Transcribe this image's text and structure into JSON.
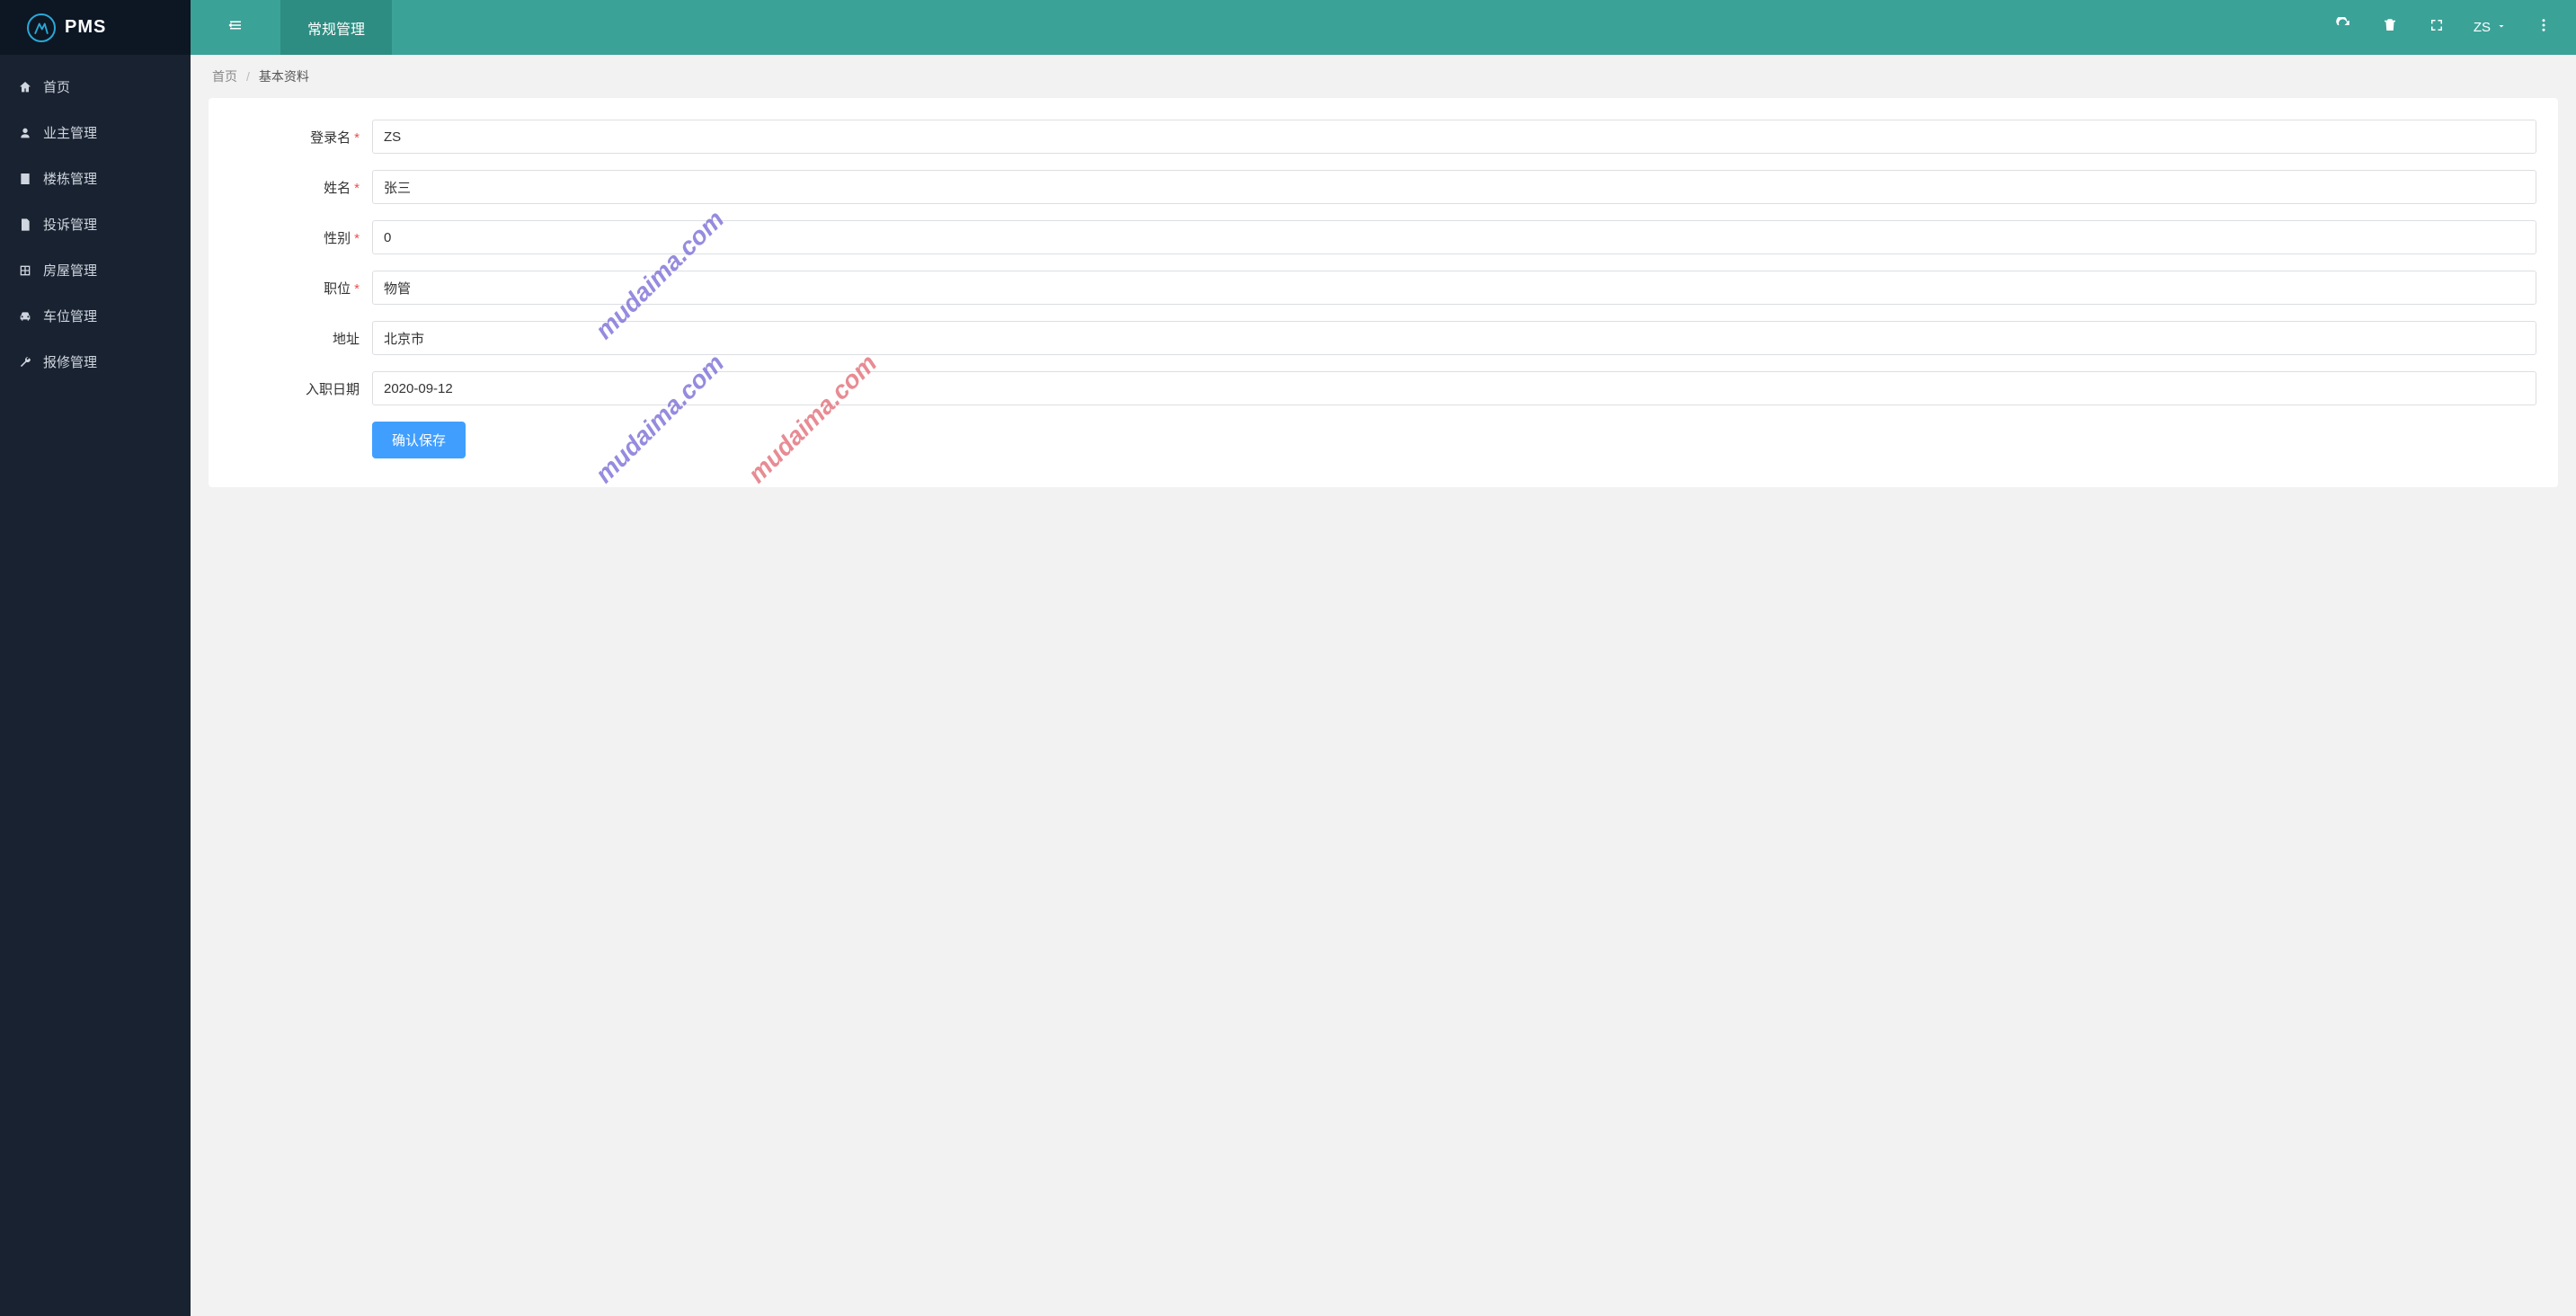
{
  "app": {
    "name": "PMS"
  },
  "sidebar": {
    "items": [
      {
        "label": "首页",
        "icon": "home"
      },
      {
        "label": "业主管理",
        "icon": "user"
      },
      {
        "label": "楼栋管理",
        "icon": "building"
      },
      {
        "label": "投诉管理",
        "icon": "file"
      },
      {
        "label": "房屋管理",
        "icon": "house"
      },
      {
        "label": "车位管理",
        "icon": "car"
      },
      {
        "label": "报修管理",
        "icon": "wrench"
      }
    ]
  },
  "topbar": {
    "active_tab": "常规管理",
    "user": "ZS"
  },
  "breadcrumb": {
    "home": "首页",
    "current": "基本资料"
  },
  "form": {
    "labels": {
      "username": "登录名",
      "name": "姓名",
      "gender": "性别",
      "position": "职位",
      "address": "地址",
      "hiredate": "入职日期"
    },
    "values": {
      "username": "ZS",
      "name": "张三",
      "gender": "0",
      "position": "物管",
      "address": "北京市",
      "hiredate": "2020-09-12"
    },
    "save_label": "确认保存"
  },
  "watermark": "mudaima.com"
}
